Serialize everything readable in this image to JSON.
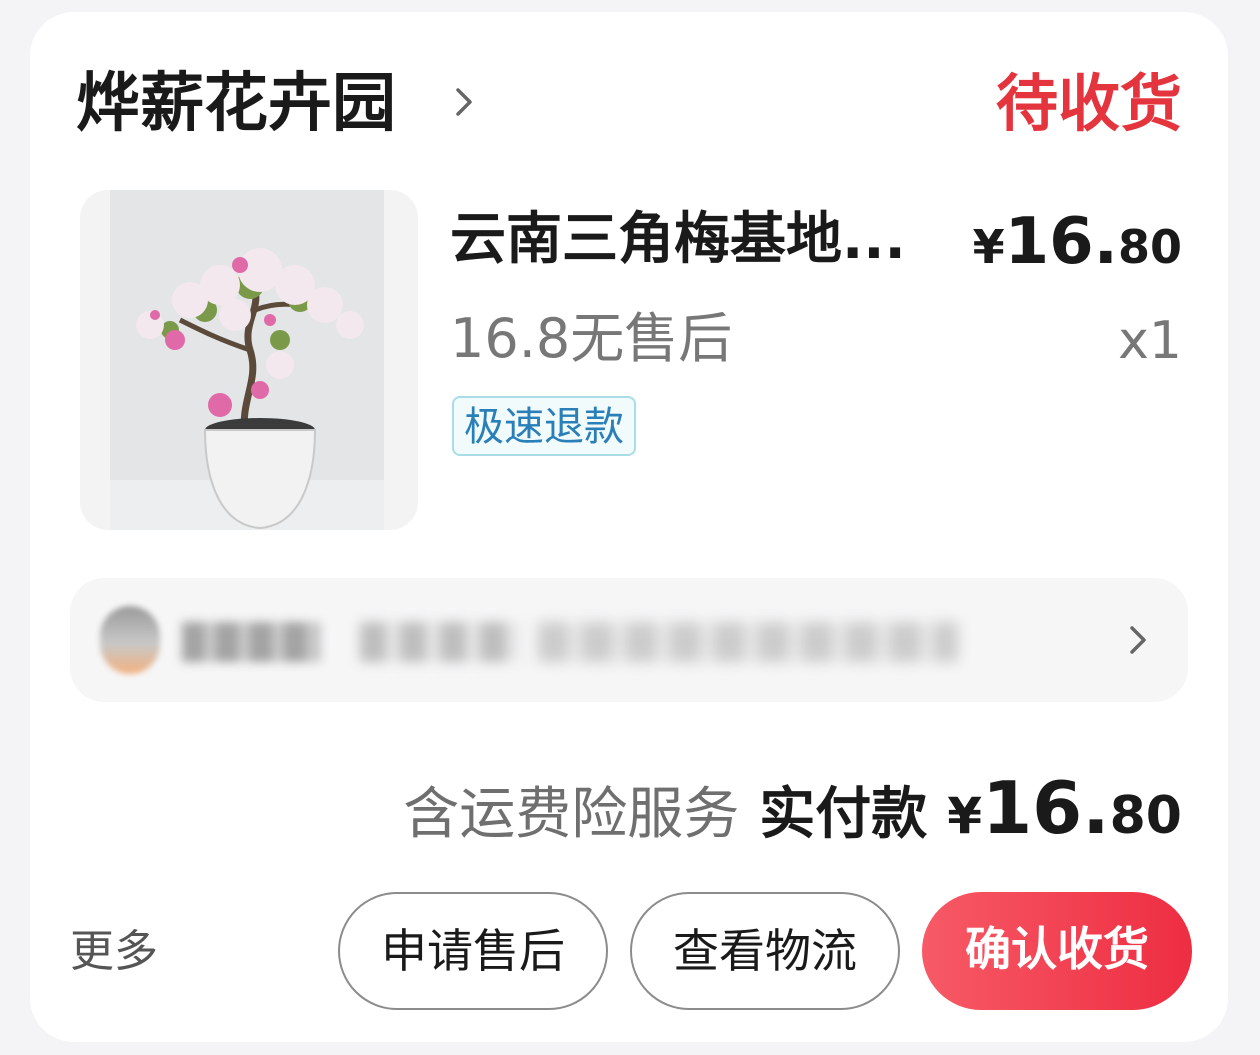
{
  "shop": {
    "name": "烨薪花卉园",
    "status": "待收货"
  },
  "product": {
    "title": "云南三角梅基地...",
    "price_yen": "¥",
    "price_int": "16.",
    "price_dec": "80",
    "subtitle": "16.8无售后",
    "quantity": "x1",
    "tag": "极速退款"
  },
  "summary": {
    "insurance": "含运费险服务",
    "paid_label": "实付款",
    "yen": "¥",
    "int": "16.",
    "dec": "80"
  },
  "actions": {
    "more": "更多",
    "aftersale": "申请售后",
    "logistics": "查看物流",
    "confirm": "确认收货"
  },
  "colors": {
    "status": "#e4353f",
    "confirm": "#ee2d42",
    "tag_text": "#2a7fb8"
  }
}
